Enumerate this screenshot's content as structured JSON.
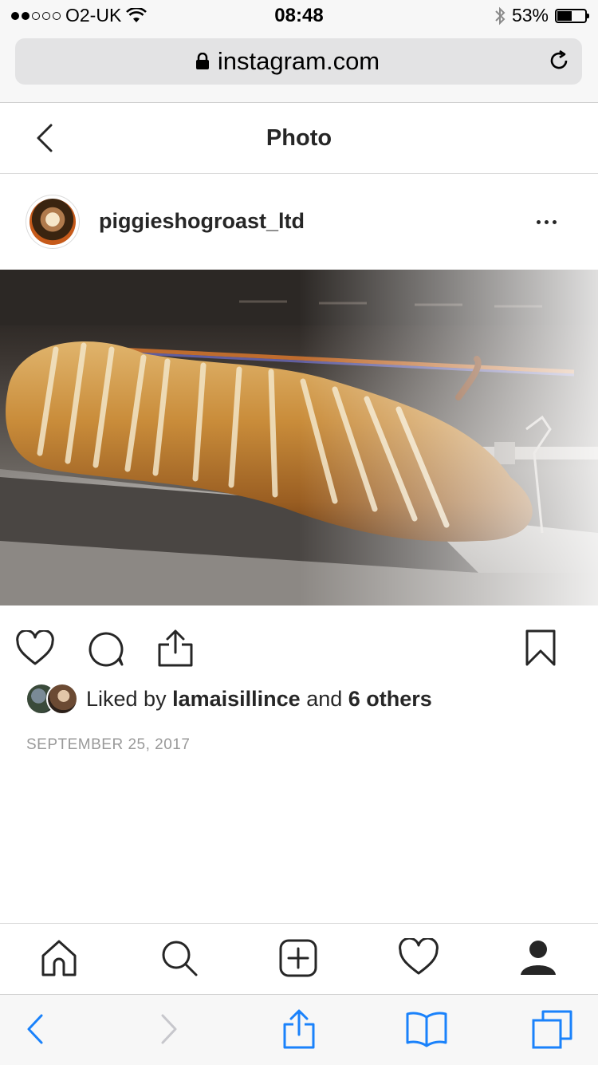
{
  "status_bar": {
    "carrier": "O2-UK",
    "time": "08:48",
    "battery": "53%",
    "battery_level": 0.53
  },
  "url_bar": {
    "domain": "instagram.com"
  },
  "header": {
    "title": "Photo"
  },
  "post": {
    "username": "piggieshogroast_ltd",
    "likes": {
      "prefix": "Liked by",
      "user": "lamaisillince",
      "middle": "and",
      "others": "6 others"
    },
    "date": "SEPTEMBER 25, 2017"
  },
  "icons": {
    "like": "heart-icon",
    "comment": "comment-bubble-icon",
    "share": "share-icon",
    "save": "bookmark-icon",
    "nav": [
      "home-icon",
      "search-icon",
      "new-post-icon",
      "activity-heart-icon",
      "profile-icon"
    ],
    "safari": [
      "back-arrow-icon",
      "forward-arrow-icon",
      "share-icon",
      "bookmarks-icon",
      "tabs-icon"
    ]
  },
  "colors": {
    "text": "#262626",
    "muted": "#999999",
    "safari_blue": "#1a82fb",
    "disabled": "#c7c7cc"
  }
}
